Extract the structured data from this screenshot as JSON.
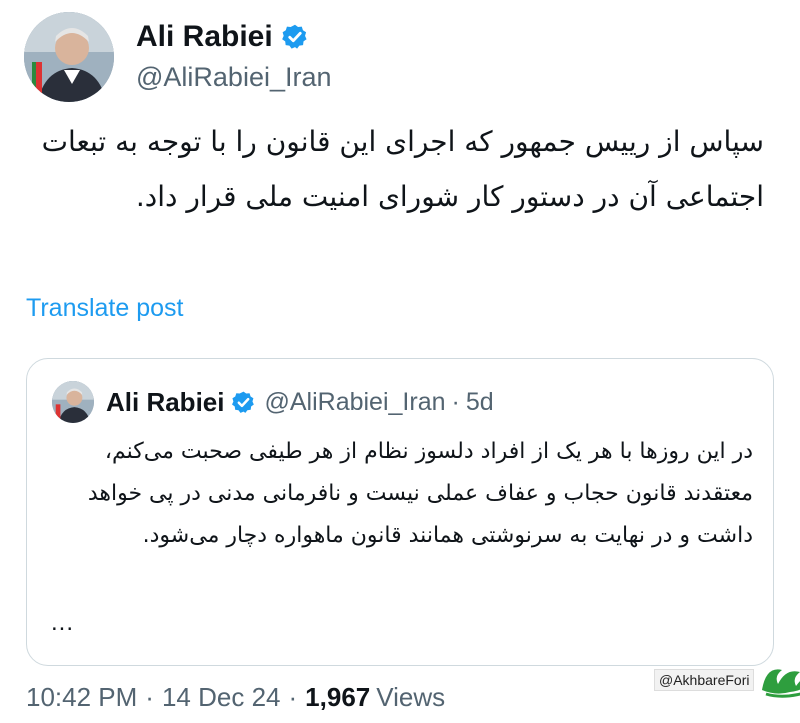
{
  "author": {
    "display_name": "Ali Rabiei",
    "handle": "@AliRabiei_Iran",
    "avatar_icon": "profile-photo",
    "verified_icon": "verified-badge-icon",
    "verified_color": "#1d9bf0"
  },
  "tweet": {
    "text": "سپاس از رییس جمهور که اجرای این قانون را با توجه به تبعات اجتماعی آن در دستور کار شورای امنیت ملی قرار داد.",
    "translate_label": "Translate post"
  },
  "quote": {
    "display_name": "Ali Rabiei",
    "handle": "@AliRabiei_Iran",
    "separator": "·",
    "time": "5d",
    "text": "در این روزها با هر یک از افراد دلسوز نظام از هر طیفی صحبت می‌کنم، معتقدند قانون حجاب و عفاف عملی نیست و نافرمانی مدنی در پی خواهد داشت و در نهایت به سرنوشتی همانند قانون ماهواره دچار می‌شود.",
    "more": "..."
  },
  "meta": {
    "time": "10:42 PM",
    "sep1": "·",
    "date": "14 Dec 24",
    "sep2": "·",
    "views_count": "1,967",
    "views_label": "Views"
  },
  "watermark": {
    "handle": "@AkhbareFori",
    "logo_icon": "akhbare-fori-logo",
    "logo_color": "#2e9e3e"
  },
  "colors": {
    "text": "#0f1419",
    "secondary": "#536471",
    "link": "#1d9bf0",
    "border": "#cfd9de"
  }
}
